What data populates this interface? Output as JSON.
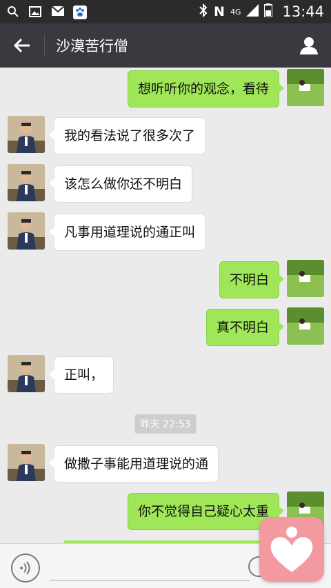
{
  "status_bar": {
    "time": "13:44",
    "network": "4G",
    "carrier_badge": "N"
  },
  "header": {
    "title": "沙漠苦行僧"
  },
  "messages": [
    {
      "side": "out",
      "text": "想听听你的观念，看待"
    },
    {
      "side": "in",
      "text": "我的看法说了很多次了"
    },
    {
      "side": "in",
      "text": "该怎么做你还不明白"
    },
    {
      "side": "in",
      "text": "凡事用道理说的通正叫"
    },
    {
      "side": "out",
      "text": "不明白"
    },
    {
      "side": "out",
      "text": "真不明白"
    },
    {
      "side": "in",
      "text": "正叫，"
    },
    {
      "side": "in",
      "text": "做撒子事能用道理说的通"
    },
    {
      "side": "out",
      "text": "你不觉得自己疑心太重"
    }
  ],
  "timestamp": "昨天 22:53",
  "colors": {
    "title_bar": "#393a3f",
    "outgoing_bubble": "#9fe658",
    "incoming_bubble": "#ffffff",
    "chat_bg": "#ebebeb",
    "widget": "#f39aa0"
  }
}
